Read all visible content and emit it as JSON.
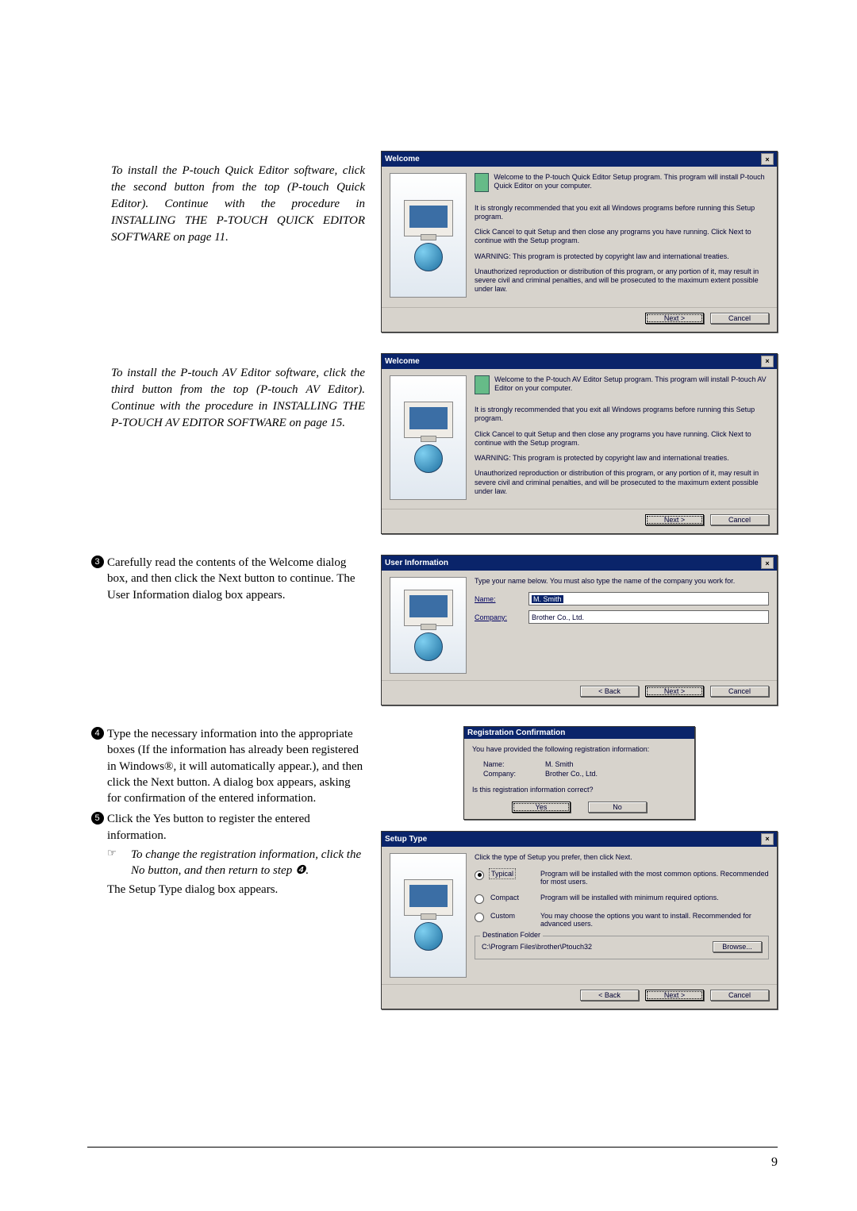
{
  "page_number": "9",
  "instructions": {
    "quick_editor_note": "To install the P-touch Quick Editor software, click the second button from the top (P-touch Quick Editor). Continue with the procedure in INSTALLING THE P-TOUCH QUICK EDITOR SOFTWARE on page 11.",
    "av_editor_note": "To install the P-touch AV Editor software, click the third button from the top (P-touch AV Editor). Continue with the procedure in INSTALLING THE P-TOUCH AV EDITOR SOFTWARE on page 15.",
    "step3": "Carefully read the contents of the Welcome dialog box, and then click the Next button to continue. The User Information dialog box appears.",
    "step4": "Type the necessary information into the appropriate boxes (If the information has already been registered in Windows®, it will automatically appear.), and then click the Next button. A dialog box appears, asking for confirmation of the entered information.",
    "step5": "Click the Yes button to register the entered information.",
    "step5_note": "To change the registration information, click the No button, and then return to step ❹.",
    "step5_after": "The Setup Type dialog box appears.",
    "note_icon": "☞",
    "bullet3": "3",
    "bullet4": "4",
    "bullet4_inline": "4",
    "bullet5": "5"
  },
  "dlg_welcome_qe": {
    "title": "Welcome",
    "intro": "Welcome to the P-touch Quick Editor Setup program. This program will install P-touch Quick Editor on your computer.",
    "rec": "It is strongly recommended that you exit all Windows programs before running this Setup program.",
    "cancel_hint": "Click Cancel to quit Setup and then close any programs you have running. Click Next to continue with the Setup program.",
    "warn": "WARNING: This program is protected by copyright law and international treaties.",
    "legal": "Unauthorized reproduction or distribution of this program, or any portion of it, may result in severe civil and criminal penalties, and will be prosecuted to the maximum extent possible under law.",
    "next": "Next >",
    "cancel": "Cancel"
  },
  "dlg_welcome_av": {
    "title": "Welcome",
    "intro": "Welcome to the P-touch AV Editor Setup program. This program will install P-touch AV Editor on your computer.",
    "rec": "It is strongly recommended that you exit all Windows programs before running this Setup program.",
    "cancel_hint": "Click Cancel to quit Setup and then close any programs you have running. Click Next to continue with the Setup program.",
    "warn": "WARNING: This program is protected by copyright law and international treaties.",
    "legal": "Unauthorized reproduction or distribution of this program, or any portion of it, may result in severe civil and criminal penalties, and will be prosecuted to the maximum extent possible under law.",
    "next": "Next >",
    "cancel": "Cancel"
  },
  "dlg_userinfo": {
    "title": "User Information",
    "prompt": "Type your name below. You must also type the name of the company you work for.",
    "name_label": "Name:",
    "name_value": "M. Smith",
    "company_label": "Company:",
    "company_value": "Brother Co., Ltd.",
    "back": "< Back",
    "next": "Next >",
    "cancel": "Cancel"
  },
  "dlg_regconf": {
    "title": "Registration Confirmation",
    "line1": "You have provided the following registration information:",
    "name_label": "Name:",
    "name_value": "M. Smith",
    "company_label": "Company:",
    "company_value": "Brother Co., Ltd.",
    "question": "Is this registration information correct?",
    "yes": "Yes",
    "no": "No"
  },
  "dlg_setup": {
    "title": "Setup Type",
    "prompt": "Click the type of Setup you prefer, then click Next.",
    "typical_label": "Typical",
    "typical_desc": "Program will be installed with the most common options. Recommended for most users.",
    "compact_label": "Compact",
    "compact_desc": "Program will be installed with minimum required options.",
    "custom_label": "Custom",
    "custom_desc": "You may choose the options you want to install. Recommended for advanced users.",
    "dest_group": "Destination Folder",
    "dest_path": "C:\\Program Files\\brother\\Ptouch32",
    "browse": "Browse...",
    "back": "< Back",
    "next": "Next >",
    "cancel": "Cancel"
  }
}
